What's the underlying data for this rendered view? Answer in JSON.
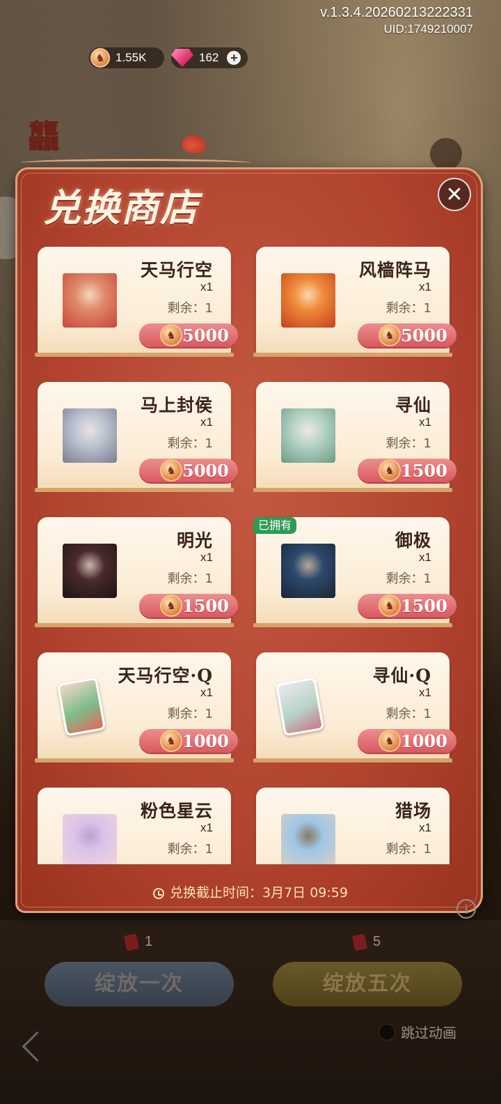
{
  "header": {
    "version": "v.1.3.4.20260213222331",
    "uid": "UID:1749210007"
  },
  "currency": {
    "horse_coin": "1.55K",
    "gems": "162"
  },
  "modal": {
    "title": "兑换商店",
    "deadline": "兑换截止时间：3月7日 09:59"
  },
  "items": [
    {
      "name": "天马行空",
      "qty": "x1",
      "remain": "剩余：1",
      "price": "5000",
      "owned": "",
      "thumb": [
        "#e08a6a",
        "#c7463a",
        "#f3d6c0"
      ]
    },
    {
      "name": "风樯阵马",
      "qty": "x1",
      "remain": "剩余：1",
      "price": "5000",
      "owned": "",
      "thumb": [
        "#f08c3a",
        "#c2411c",
        "#f8d8b0"
      ]
    },
    {
      "name": "马上封侯",
      "qty": "x1",
      "remain": "剩余：1",
      "price": "5000",
      "owned": "",
      "thumb": [
        "#bfc5d2",
        "#7a7f92",
        "#e9e2df"
      ]
    },
    {
      "name": "寻仙",
      "qty": "x1",
      "remain": "剩余：1",
      "price": "1500",
      "owned": "",
      "thumb": [
        "#b8d6c6",
        "#6d9a88",
        "#f0e6e4"
      ]
    },
    {
      "name": "明光",
      "qty": "x1",
      "remain": "剩余：1",
      "price": "1500",
      "owned": "",
      "thumb": [
        "#4a2a2a",
        "#1e1414",
        "#c9b6b0"
      ]
    },
    {
      "name": "御极",
      "qty": "x1",
      "remain": "剩余：1",
      "price": "1500",
      "owned": "已拥有",
      "thumb": [
        "#2d4a6e",
        "#1b2434",
        "#b5a89a"
      ]
    },
    {
      "name": "天马行空·Q",
      "qty": "x1",
      "remain": "剩余：1",
      "price": "1000",
      "owned": "",
      "thumb": [
        "#f5d6c8",
        "#7bbd8a",
        "#e8685a"
      ]
    },
    {
      "name": "寻仙·Q",
      "qty": "x1",
      "remain": "剩余：1",
      "price": "1000",
      "owned": "",
      "thumb": [
        "#eee7ee",
        "#b6d4c8",
        "#c9788a"
      ]
    },
    {
      "name": "粉色星云",
      "qty": "x1",
      "remain": "剩余：1",
      "price": "",
      "owned": "",
      "thumb": [
        "#d9c4e8",
        "#f2d2df",
        "#b9a2d2"
      ]
    },
    {
      "name": "猎场",
      "qty": "x1",
      "remain": "剩余：1",
      "price": "",
      "owned": "",
      "thumb": [
        "#9fc7e8",
        "#d8d0c0",
        "#8a7a62"
      ]
    }
  ],
  "bottom": {
    "ticket_once": "1",
    "ticket_five": "5",
    "btn_once": "绽放一次",
    "btn_five": "绽放五次",
    "skip": "跳过动画"
  },
  "colors": {
    "modal_red": "#b1432f",
    "price_pink": "#d9595f",
    "owned_green": "#2e9a54"
  }
}
